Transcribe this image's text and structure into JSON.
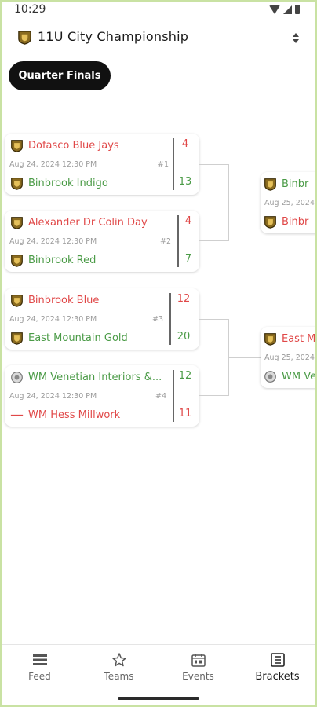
{
  "status": {
    "time": "10:29"
  },
  "header": {
    "title": "11U City Championship"
  },
  "round": {
    "label": "Quarter Finals"
  },
  "matches": [
    {
      "number": "#1",
      "date": "Aug 24, 2024 12:30 PM",
      "team_a": {
        "name": "Dofasco Blue Jays",
        "score": "4",
        "result": "loser"
      },
      "team_b": {
        "name": "Binbrook Indigo",
        "score": "13",
        "result": "winner"
      }
    },
    {
      "number": "#2",
      "date": "Aug 24, 2024 12:30 PM",
      "team_a": {
        "name": "Alexander Dr Colin Day",
        "score": "4",
        "result": "loser"
      },
      "team_b": {
        "name": "Binbrook Red",
        "score": "7",
        "result": "winner"
      }
    },
    {
      "number": "#3",
      "date": "Aug 24, 2024 12:30 PM",
      "team_a": {
        "name": "Binbrook Blue",
        "score": "12",
        "result": "loser"
      },
      "team_b": {
        "name": "East Mountain Gold",
        "score": "20",
        "result": "winner"
      }
    },
    {
      "number": "#4",
      "date": "Aug 24, 2024 12:30 PM",
      "team_a": {
        "name": "WM Venetian Interiors &...",
        "score": "12",
        "result": "winner"
      },
      "team_b": {
        "name": "WM Hess Millwork",
        "score": "11",
        "result": "loser"
      }
    }
  ],
  "next_round": [
    {
      "date": "Aug 25, 2024",
      "team_a": {
        "name": "Binbr",
        "result": "winner"
      },
      "team_b": {
        "name": "Binbr",
        "result": "loser"
      }
    },
    {
      "date": "Aug 25, 2024",
      "team_a": {
        "name": "East M",
        "result": "loser"
      },
      "team_b": {
        "name": "WM Ve",
        "result": "winner"
      }
    }
  ],
  "nav": {
    "items": [
      {
        "label": "Feed",
        "icon": "feed-icon"
      },
      {
        "label": "Teams",
        "icon": "star-icon"
      },
      {
        "label": "Events",
        "icon": "calendar-icon"
      },
      {
        "label": "Brackets",
        "icon": "bracket-icon"
      }
    ],
    "active": "Brackets"
  },
  "colors": {
    "winner": "#4b9b47",
    "loser": "#e04848",
    "pill": "#111111"
  }
}
